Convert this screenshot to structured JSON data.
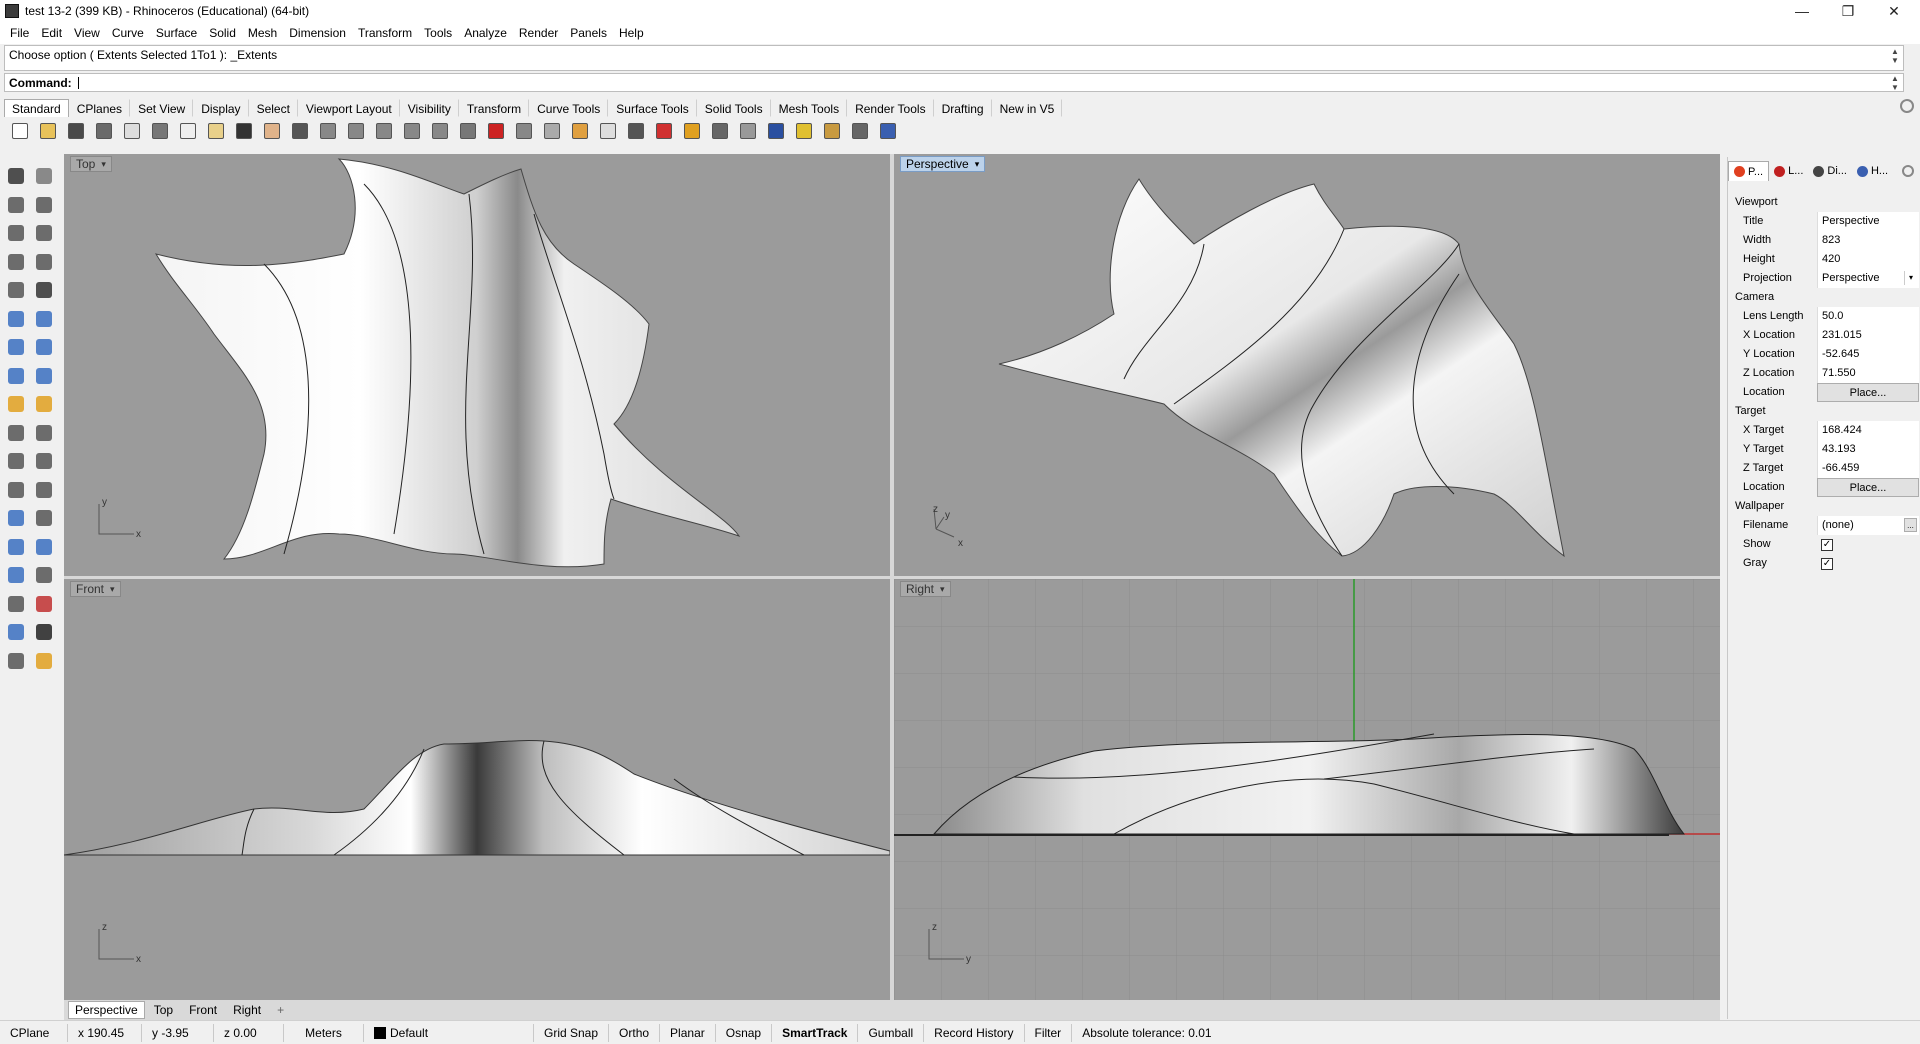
{
  "window": {
    "title": "test 13-2 (399 KB) - Rhinoceros (Educational) (64-bit)",
    "minimize_glyph": "—",
    "restore_glyph": "❐",
    "close_glyph": "✕"
  },
  "menu": [
    "File",
    "Edit",
    "View",
    "Curve",
    "Surface",
    "Solid",
    "Mesh",
    "Dimension",
    "Transform",
    "Tools",
    "Analyze",
    "Render",
    "Panels",
    "Help"
  ],
  "command": {
    "history": "Choose option ( Extents  Selected  1To1 ): _Extents",
    "prompt": "Command:",
    "value": ""
  },
  "toolbar_tabs": [
    "Standard",
    "CPlanes",
    "Set View",
    "Display",
    "Select",
    "Viewport Layout",
    "Visibility",
    "Transform",
    "Curve Tools",
    "Surface Tools",
    "Solid Tools",
    "Mesh Tools",
    "Render Tools",
    "Drafting",
    "New in V5"
  ],
  "toolbar_active_tab": "Standard",
  "toolbar_icons": [
    {
      "name": "new-icon",
      "color": "#ffffff"
    },
    {
      "name": "open-icon",
      "color": "#e8c25a"
    },
    {
      "name": "save-icon",
      "color": "#4a4a4a"
    },
    {
      "name": "print-icon",
      "color": "#6a6a6a"
    },
    {
      "name": "import-icon",
      "color": "#dddddd"
    },
    {
      "name": "cut-icon",
      "color": "#777777"
    },
    {
      "name": "copy-icon",
      "color": "#eeeeee"
    },
    {
      "name": "paste-icon",
      "color": "#e8d08a"
    },
    {
      "name": "undo-icon",
      "color": "#333333"
    },
    {
      "name": "pan-icon",
      "color": "#e0b38a"
    },
    {
      "name": "rotate-view-icon",
      "color": "#555555"
    },
    {
      "name": "zoom-icon",
      "color": "#888888"
    },
    {
      "name": "zoom-window-icon",
      "color": "#888888"
    },
    {
      "name": "zoom-extents-icon",
      "color": "#888888"
    },
    {
      "name": "zoom-selected-icon",
      "color": "#888888"
    },
    {
      "name": "undo-view-icon",
      "color": "#888888"
    },
    {
      "name": "four-viewports-icon",
      "color": "#777777"
    },
    {
      "name": "named-views-icon",
      "color": "#cc2222"
    },
    {
      "name": "named-cplanes-icon",
      "color": "#888888"
    },
    {
      "name": "cplane-icon",
      "color": "#aaaaaa"
    },
    {
      "name": "osnap-icon",
      "color": "#e0a040"
    },
    {
      "name": "light-icon",
      "color": "#dddddd"
    },
    {
      "name": "lock-icon",
      "color": "#555555"
    },
    {
      "name": "layer-icon",
      "color": "#d03030"
    },
    {
      "name": "color-wheel-icon",
      "color": "#e0a020"
    },
    {
      "name": "render-sphere-icon",
      "color": "#666666"
    },
    {
      "name": "material-sphere-icon",
      "color": "#999999"
    },
    {
      "name": "environment-sphere-icon",
      "color": "#2a4fa0"
    },
    {
      "name": "select-filter-icon",
      "color": "#e0c030"
    },
    {
      "name": "options-icon",
      "color": "#c89a40"
    },
    {
      "name": "dimension-icon",
      "color": "#666666"
    },
    {
      "name": "help-icon",
      "color": "#3a5fb0"
    }
  ],
  "left_tools": [
    {
      "name": "select-icon",
      "color": "#333333"
    },
    {
      "name": "point-icon",
      "color": "#777777"
    },
    {
      "name": "polyline-icon",
      "color": "#555555"
    },
    {
      "name": "curve-icon",
      "color": "#555555"
    },
    {
      "name": "circle-icon",
      "color": "#555555"
    },
    {
      "name": "ellipse-icon",
      "color": "#555555"
    },
    {
      "name": "polygon-icon",
      "color": "#555555"
    },
    {
      "name": "rectangle-icon",
      "color": "#555555"
    },
    {
      "name": "circle-tangent-icon",
      "color": "#555555"
    },
    {
      "name": "arc-icon",
      "color": "#333333"
    },
    {
      "name": "surface-edit-icon",
      "color": "#3a6fc0"
    },
    {
      "name": "surface-blend-icon",
      "color": "#3a6fc0"
    },
    {
      "name": "box-icon",
      "color": "#3a6fc0"
    },
    {
      "name": "boolean-icon",
      "color": "#3a6fc0"
    },
    {
      "name": "cylinder-icon",
      "color": "#3a6fc0"
    },
    {
      "name": "plane-surface-icon",
      "color": "#3a6fc0"
    },
    {
      "name": "explode-icon",
      "color": "#e0a020"
    },
    {
      "name": "lightning-icon",
      "color": "#e0a020"
    },
    {
      "name": "trim-icon",
      "color": "#555555"
    },
    {
      "name": "split-icon",
      "color": "#555555"
    },
    {
      "name": "join-icon",
      "color": "#555555"
    },
    {
      "name": "group-icon",
      "color": "#555555"
    },
    {
      "name": "fillet-icon",
      "color": "#555555"
    },
    {
      "name": "chamfer-icon",
      "color": "#555555"
    },
    {
      "name": "text-icon",
      "color": "#3a6fc0"
    },
    {
      "name": "move-icon",
      "color": "#555555"
    },
    {
      "name": "array-icon",
      "color": "#3a6fc0"
    },
    {
      "name": "mirror-icon",
      "color": "#3a6fc0"
    },
    {
      "name": "extrude-icon",
      "color": "#3a6fc0"
    },
    {
      "name": "hatch-icon",
      "color": "#555555"
    },
    {
      "name": "point-grid-icon",
      "color": "#555555"
    },
    {
      "name": "analyze-icon",
      "color": "#c03030"
    },
    {
      "name": "edit-points-icon",
      "color": "#3a6fc0"
    },
    {
      "name": "check-icon",
      "color": "#222222"
    },
    {
      "name": "render-icon",
      "color": "#555555"
    },
    {
      "name": "paint-icon",
      "color": "#e0a020"
    }
  ],
  "viewports": {
    "top": {
      "label": "Top",
      "x_axis": "x",
      "y_axis": "y"
    },
    "perspective": {
      "label": "Perspective",
      "x_axis": "x",
      "y_axis": "y",
      "z_axis": "z"
    },
    "front": {
      "label": "Front",
      "x_axis": "x",
      "z_axis": "z"
    },
    "right": {
      "label": "Right",
      "y_axis": "y",
      "z_axis": "z"
    },
    "dropdown_glyph": "▾"
  },
  "viewport_tabs": [
    "Perspective",
    "Top",
    "Front",
    "Right"
  ],
  "viewport_tabs_active": "Perspective",
  "viewport_tabs_add": "+",
  "panel": {
    "tabs": [
      {
        "label": "P...",
        "icon": "properties-icon",
        "color": "#e04020"
      },
      {
        "label": "L...",
        "icon": "layers-icon",
        "color": "#c02020"
      },
      {
        "label": "Di...",
        "icon": "display-icon",
        "color": "#444444"
      },
      {
        "label": "H...",
        "icon": "help-icon",
        "color": "#3a5fb0"
      }
    ],
    "sections": {
      "viewport": {
        "header": "Viewport",
        "title": {
          "label": "Title",
          "value": "Perspective"
        },
        "width": {
          "label": "Width",
          "value": "823"
        },
        "height": {
          "label": "Height",
          "value": "420"
        },
        "projection": {
          "label": "Projection",
          "value": "Perspective"
        }
      },
      "camera": {
        "header": "Camera",
        "lens": {
          "label": "Lens Length",
          "value": "50.0"
        },
        "x": {
          "label": "X Location",
          "value": "231.015"
        },
        "y": {
          "label": "Y Location",
          "value": "-52.645"
        },
        "z": {
          "label": "Z Location",
          "value": "71.550"
        },
        "location": {
          "label": "Location",
          "button": "Place..."
        }
      },
      "target": {
        "header": "Target",
        "x": {
          "label": "X Target",
          "value": "168.424"
        },
        "y": {
          "label": "Y Target",
          "value": "43.193"
        },
        "z": {
          "label": "Z Target",
          "value": "-66.459"
        },
        "location": {
          "label": "Location",
          "button": "Place..."
        }
      },
      "wallpaper": {
        "header": "Wallpaper",
        "filename": {
          "label": "Filename",
          "value": "(none)",
          "button": "..."
        },
        "show": {
          "label": "Show",
          "checked": true
        },
        "gray": {
          "label": "Gray",
          "checked": true
        }
      }
    }
  },
  "status": {
    "cplane": "CPlane",
    "x": "x 190.45",
    "y": "y -3.95",
    "z": "z 0.00",
    "units": "Meters",
    "layer": "Default",
    "grid_snap": "Grid Snap",
    "ortho": "Ortho",
    "planar": "Planar",
    "osnap": "Osnap",
    "smarttrack": "SmartTrack",
    "gumball": "Gumball",
    "record_history": "Record History",
    "filter": "Filter",
    "tolerance": "Absolute tolerance: 0.01"
  }
}
